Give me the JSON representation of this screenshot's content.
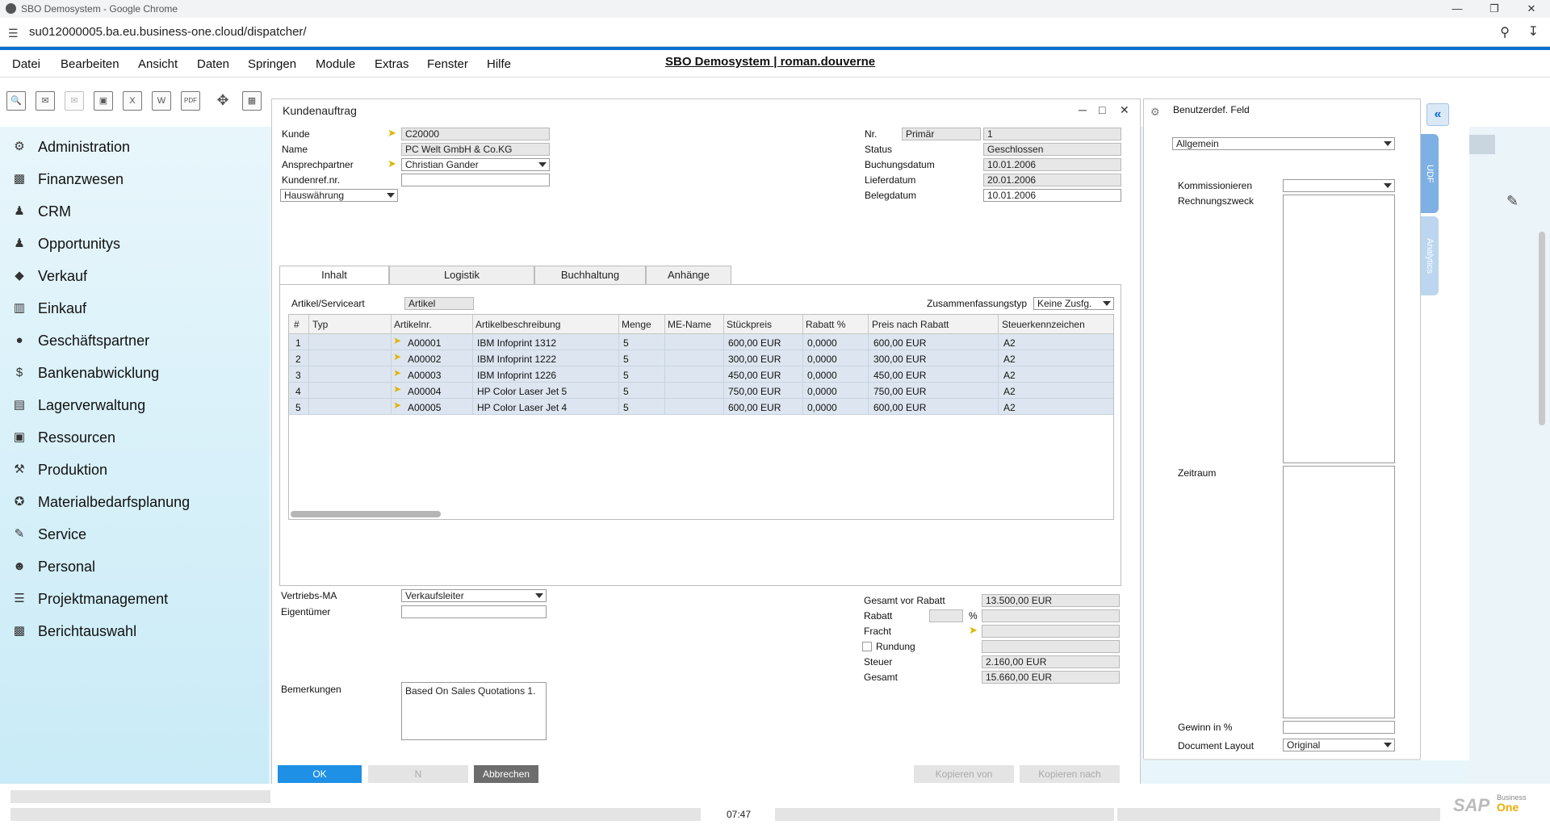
{
  "browser": {
    "title": "SBO Demosystem - Google Chrome",
    "url": "su012000005.ba.eu.business-one.cloud/dispatcher/"
  },
  "menu": {
    "items": [
      "Datei",
      "Bearbeiten",
      "Ansicht",
      "Daten",
      "Springen",
      "Module",
      "Extras",
      "Fenster",
      "Hilfe"
    ],
    "system_title": "SBO Demosystem | roman.douverne"
  },
  "sidebar": {
    "items": [
      {
        "label": "Administration",
        "icon": "gear-icon"
      },
      {
        "label": "Finanzwesen",
        "icon": "chart-icon"
      },
      {
        "label": "CRM",
        "icon": "people-icon"
      },
      {
        "label": "Opportunitys",
        "icon": "opportunity-icon"
      },
      {
        "label": "Verkauf",
        "icon": "tag-icon"
      },
      {
        "label": "Einkauf",
        "icon": "cart-icon"
      },
      {
        "label": "Geschäftspartner",
        "icon": "person-icon"
      },
      {
        "label": "Bankenabwicklung",
        "icon": "dollar-icon"
      },
      {
        "label": "Lagerverwaltung",
        "icon": "warehouse-icon"
      },
      {
        "label": "Ressourcen",
        "icon": "resources-icon"
      },
      {
        "label": "Produktion",
        "icon": "production-icon"
      },
      {
        "label": "Materialbedarfsplanung",
        "icon": "puzzle-icon"
      },
      {
        "label": "Service",
        "icon": "service-icon"
      },
      {
        "label": "Personal",
        "icon": "personnel-icon"
      },
      {
        "label": "Projektmanagement",
        "icon": "project-icon"
      },
      {
        "label": "Berichtauswahl",
        "icon": "report-icon"
      }
    ]
  },
  "form": {
    "title": "Kundenauftrag",
    "header_left": {
      "kunde_label": "Kunde",
      "kunde_value": "C20000",
      "name_label": "Name",
      "name_value": "PC Welt GmbH & Co.KG",
      "ansprech_label": "Ansprechpartner",
      "ansprech_value": "Christian Gander",
      "kundenref_label": "Kundenref.nr.",
      "kundenref_value": "",
      "waehrung_value": "Hauswährung"
    },
    "header_right": {
      "nr_label": "Nr.",
      "nr_series": "Primär",
      "nr_value": "1",
      "status_label": "Status",
      "status_value": "Geschlossen",
      "buchung_label": "Buchungsdatum",
      "buchung_value": "10.01.2006",
      "liefer_label": "Lieferdatum",
      "liefer_value": "20.01.2006",
      "beleg_label": "Belegdatum",
      "beleg_value": "10.01.2006"
    },
    "tabs": [
      "Inhalt",
      "Logistik",
      "Buchhaltung",
      "Anhänge"
    ],
    "content": {
      "artikel_label": "Artikel/Serviceart",
      "artikel_value": "Artikel",
      "summary_label": "Zusammenfassungstyp",
      "summary_value": "Keine Zusfg."
    },
    "grid": {
      "columns": [
        "#",
        "Typ",
        "Artikelnr.",
        "Artikelbeschreibung",
        "Menge",
        "ME-Name",
        "Stückpreis",
        "Rabatt %",
        "Preis nach Rabatt",
        "Steuerkennzeichen"
      ],
      "rows": [
        {
          "n": "1",
          "typ": "",
          "nr": "A00001",
          "desc": "IBM Infoprint 1312",
          "menge": "5",
          "me": "",
          "preis": "600,00 EUR",
          "rabatt": "0,0000",
          "nach": "600,00 EUR",
          "steuer": "A2"
        },
        {
          "n": "2",
          "typ": "",
          "nr": "A00002",
          "desc": "IBM Infoprint 1222",
          "menge": "5",
          "me": "",
          "preis": "300,00 EUR",
          "rabatt": "0,0000",
          "nach": "300,00 EUR",
          "steuer": "A2"
        },
        {
          "n": "3",
          "typ": "",
          "nr": "A00003",
          "desc": "IBM Infoprint 1226",
          "menge": "5",
          "me": "",
          "preis": "450,00 EUR",
          "rabatt": "0,0000",
          "nach": "450,00 EUR",
          "steuer": "A2"
        },
        {
          "n": "4",
          "typ": "",
          "nr": "A00004",
          "desc": "HP Color Laser Jet 5",
          "menge": "5",
          "me": "",
          "preis": "750,00 EUR",
          "rabatt": "0,0000",
          "nach": "750,00 EUR",
          "steuer": "A2"
        },
        {
          "n": "5",
          "typ": "",
          "nr": "A00005",
          "desc": "HP Color Laser Jet 4",
          "menge": "5",
          "me": "",
          "preis": "600,00 EUR",
          "rabatt": "0,0000",
          "nach": "600,00 EUR",
          "steuer": "A2"
        }
      ]
    },
    "footer_left": {
      "vertrieb_label": "Vertriebs-MA",
      "vertrieb_value": "Verkaufsleiter",
      "eigentuemer_label": "Eigentümer",
      "eigentuemer_value": "",
      "bemerk_label": "Bemerkungen",
      "bemerk_value": "Based On Sales Quotations 1."
    },
    "totals": {
      "gesamt_vor_label": "Gesamt vor Rabatt",
      "gesamt_vor_value": "13.500,00 EUR",
      "rabatt_label": "Rabatt",
      "rabatt_pct": "",
      "rabatt_pct_sign": "%",
      "rabatt_value": "",
      "fracht_label": "Fracht",
      "fracht_value": "",
      "rundung_label": "Rundung",
      "rundung_value": "",
      "steuer_label": "Steuer",
      "steuer_value": "2.160,00 EUR",
      "gesamt_label": "Gesamt",
      "gesamt_value": "15.660,00 EUR"
    },
    "buttons": {
      "ok": "OK",
      "n": "N",
      "abbrechen": "Abbrechen",
      "kopieren_von": "Kopieren von",
      "kopieren_nach": "Kopieren nach"
    }
  },
  "udf": {
    "title": "Benutzerdef. Feld",
    "category": "Allgemein",
    "kommission_label": "Kommissionieren",
    "kommission_value": "",
    "rechnung_label": "Rechnungszweck",
    "rechnung_value": "",
    "zeitraum_label": "Zeitraum",
    "zeitraum_value": "",
    "gewinn_label": "Gewinn in %",
    "gewinn_value": "",
    "layout_label": "Document Layout",
    "layout_value": "Original",
    "side_tabs": [
      "UDF",
      "Analytics"
    ]
  },
  "status": {
    "time": "07:47",
    "logo_main": "SAP",
    "logo_sub": "Business",
    "logo_one": "One"
  },
  "colors": {
    "accent": "#0a6ed1",
    "sidebar_bg": "#d4eff8",
    "row_bg": "#dde6f0",
    "ok_btn": "#1e90e6"
  }
}
